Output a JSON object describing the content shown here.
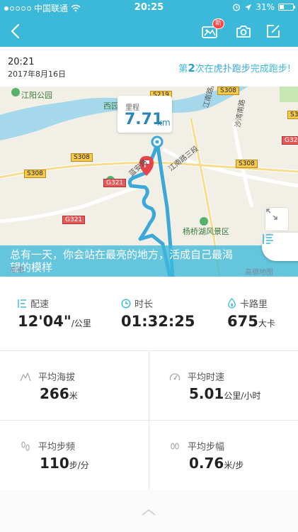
{
  "status_bar": {
    "carrier": "中国联通",
    "time": "20:25",
    "battery": "31%",
    "battery_level": 0.31
  },
  "nav": {
    "badge": "新"
  },
  "header": {
    "time": "20:21",
    "date": "2017年8月16日",
    "count_prefix": "第",
    "count_num": "2",
    "count_mid": "次在",
    "count_brand": "虎扑跑步",
    "count_suffix": "完成跑步!"
  },
  "map": {
    "distance_label": "里程",
    "distance_value": "7.71",
    "distance_unit": "km",
    "place_labels": [
      "江阳公园",
      "西园",
      "杨桥湖风景区",
      "江南路四段",
      "沙湾南路",
      "江南路三段",
      "蓝安路"
    ],
    "road_badges": [
      "S219",
      "S308",
      "S308",
      "S308",
      "S308",
      "S3",
      "G321",
      "G321",
      "G321"
    ],
    "quote": "总有一天，你会站在最亮的地方，活成自己最渴望的模样",
    "logo": "高德地图",
    "corner": "高德"
  },
  "stats": {
    "pace": {
      "label": "配速",
      "value": "12'04\"",
      "unit": "/公里"
    },
    "duration": {
      "label": "时长",
      "value": "01:32:25"
    },
    "calories": {
      "label": "卡路里",
      "value": "675",
      "unit": "大卡"
    },
    "altitude": {
      "label": "平均海拔",
      "value": "266",
      "unit": "米"
    },
    "speed": {
      "label": "平均时速",
      "value": "5.01",
      "unit": "公里/小时"
    },
    "cadence": {
      "label": "平均步频",
      "value": "110",
      "unit": "步/分"
    },
    "stride": {
      "label": "平均步幅",
      "value": "0.76",
      "unit": "米/步"
    }
  },
  "colors": {
    "accent": "#3cb8d8",
    "route": "#3aa8d8",
    "start_marker": "#e8424a"
  }
}
